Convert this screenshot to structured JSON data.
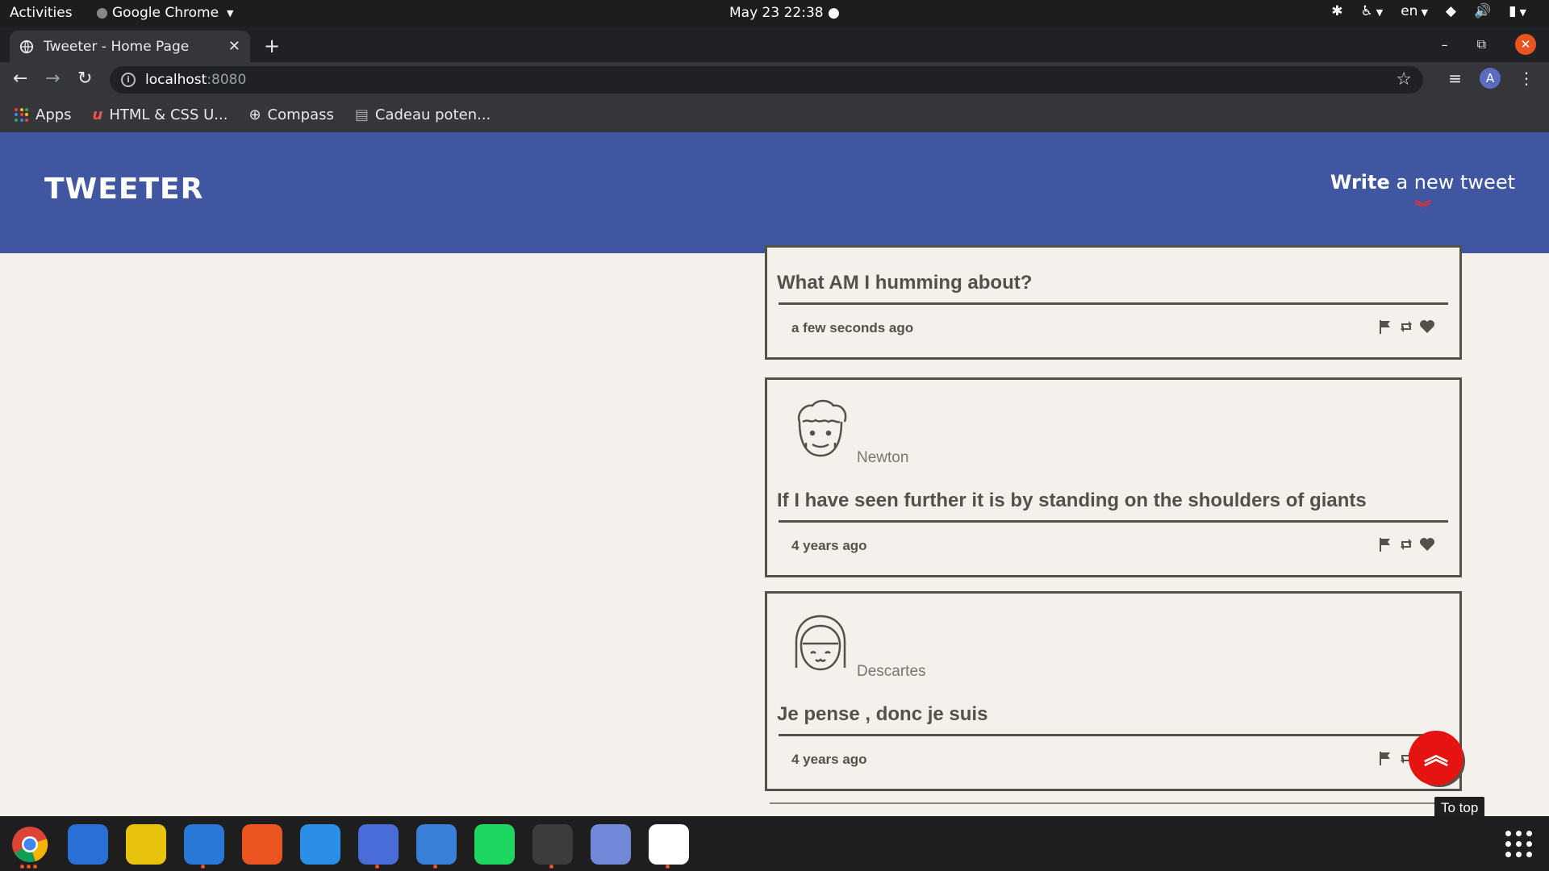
{
  "topbar": {
    "activities": "Activities",
    "app_name": "Google Chrome",
    "clock": "May 23  22:38",
    "lang": "en"
  },
  "browser": {
    "tab_title": "Tweeter - Home Page",
    "url_host": "localhost",
    "url_port": ":8080",
    "bookmarks": [
      {
        "label": "Apps",
        "icon": "apps-grid-icon"
      },
      {
        "label": "HTML & CSS U...",
        "icon": "udemy-icon"
      },
      {
        "label": "Compass",
        "icon": "compass-icon"
      },
      {
        "label": "Cadeau poten...",
        "icon": "page-icon"
      }
    ],
    "avatar_letter": "A"
  },
  "app": {
    "logo": "TWEETER",
    "compose_strong": "Write",
    "compose_rest": "a new tweet",
    "colors": {
      "nav": "#4056a1",
      "accent": "#e61313",
      "ink": "#545149",
      "bg": "#f4f1ec"
    }
  },
  "tweets": [
    {
      "handle": "",
      "content": "What AM I humming about?",
      "age": "a few seconds ago"
    },
    {
      "handle": "Newton",
      "content": "If I have seen further it is by standing on the shoulders of giants",
      "age": "4 years ago"
    },
    {
      "handle": "Descartes",
      "content": "Je pense , donc je suis",
      "age": "4 years ago"
    }
  ],
  "to_top": {
    "tooltip": "To top"
  },
  "dock": [
    {
      "name": "chrome",
      "color": "#ffffff"
    },
    {
      "name": "thunderbird",
      "color": "#2a6fd6"
    },
    {
      "name": "rhythmbox",
      "color": "#e8c30e"
    },
    {
      "name": "libreoffice-writer",
      "color": "#2a78d6"
    },
    {
      "name": "software-center",
      "color": "#e95420"
    },
    {
      "name": "help",
      "color": "#2a8ee6"
    },
    {
      "name": "tasks",
      "color": "#4a6cd8"
    },
    {
      "name": "notes",
      "color": "#3a7fd8"
    },
    {
      "name": "spotify",
      "color": "#1ed760"
    },
    {
      "name": "terminal",
      "color": "#3c3c3c"
    },
    {
      "name": "discord",
      "color": "#7289da"
    },
    {
      "name": "slack",
      "color": "#ffffff"
    }
  ]
}
